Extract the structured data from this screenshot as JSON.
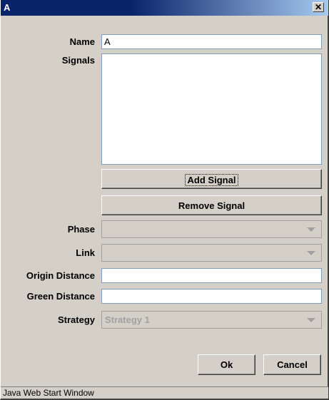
{
  "window": {
    "title": "A",
    "close_glyph": "✕"
  },
  "form": {
    "name_label": "Name",
    "name_value": "A",
    "signals_label": "Signals",
    "signals": [],
    "add_signal_label": "Add Signal",
    "remove_signal_label": "Remove Signal",
    "phase_label": "Phase",
    "phase_value": "",
    "link_label": "Link",
    "link_value": "",
    "origin_distance_label": "Origin Distance",
    "origin_distance_value": "",
    "green_distance_label": "Green Distance",
    "green_distance_value": "",
    "strategy_label": "Strategy",
    "strategy_value": "Strategy 1"
  },
  "actions": {
    "ok_label": "Ok",
    "cancel_label": "Cancel"
  },
  "status": {
    "text": "Java Web Start Window"
  },
  "colors": {
    "title_gradient_start": "#0a246a",
    "title_gradient_end": "#a6caf0",
    "face": "#d4d0c8"
  },
  "icons": {
    "dropdown": "chevron-down-icon",
    "close": "close-icon"
  }
}
